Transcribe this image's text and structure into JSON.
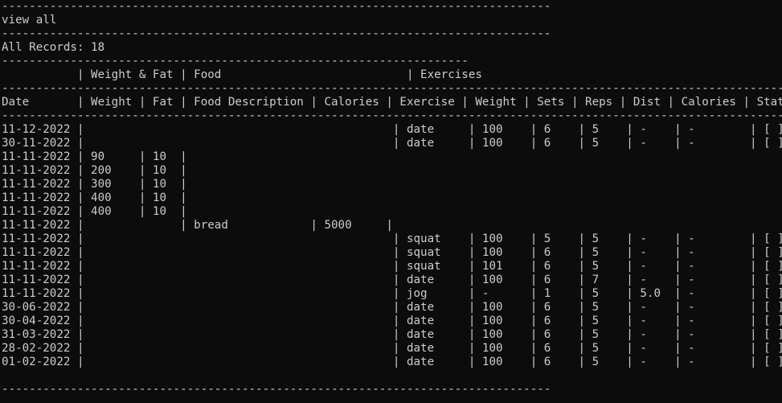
{
  "terminal": {
    "lines": [
      "--------------------------------------------------------------------------------",
      "view all",
      "--------------------------------------------------------------------------------",
      "All Records: 18",
      "--------------------------------------------------------------------",
      "           | Weight & Fat | Food                           | Exercises",
      "----------------------------------------------------------------------------------------------------------------------------",
      "Date       | Weight | Fat | Food Description | Calories | Exercise | Weight | Sets | Reps | Dist | Calories | Status |",
      "----------------------------------------------------------------------------------------------------------------------------",
      "11-12-2022 |                                             | date     | 100    | 6    | 5    | -    | -        | [ ]",
      "30-11-2022 |                                             | date     | 100    | 6    | 5    | -    | -        | [ ]",
      "11-11-2022 | 90     | 10  |",
      "11-11-2022 | 200    | 10  |",
      "11-11-2022 | 300    | 10  |",
      "11-11-2022 | 400    | 10  |",
      "11-11-2022 | 400    | 10  |",
      "11-11-2022 |              | bread            | 5000     |",
      "11-11-2022 |                                             | squat    | 100    | 5    | 5    | -    | -        | [ ]",
      "11-11-2022 |                                             | squat    | 100    | 6    | 5    | -    | -        | [ ]",
      "11-11-2022 |                                             | squat    | 101    | 6    | 5    | -    | -        | [ ]",
      "11-11-2022 |                                             | date     | 100    | 6    | 7    | -    | -        | [ ]",
      "11-11-2022 |                                             | jog      | -      | 1    | 5    | 5.0  | -        | [ ]",
      "30-06-2022 |                                             | date     | 100    | 6    | 5    | -    | -        | [ ]",
      "30-04-2022 |                                             | date     | 100    | 6    | 5    | -    | -        | [ ]",
      "31-03-2022 |                                             | date     | 100    | 6    | 5    | -    | -        | [ ]",
      "28-02-2022 |                                             | date     | 100    | 6    | 5    | -    | -        | [ ]",
      "01-02-2022 |                                             | date     | 100    | 6    | 5    | -    | -        | [ ]",
      "",
      "--------------------------------------------------------------------------------"
    ],
    "colors": {
      "background": "#0c0c0c",
      "foreground": "#cccccc"
    }
  }
}
